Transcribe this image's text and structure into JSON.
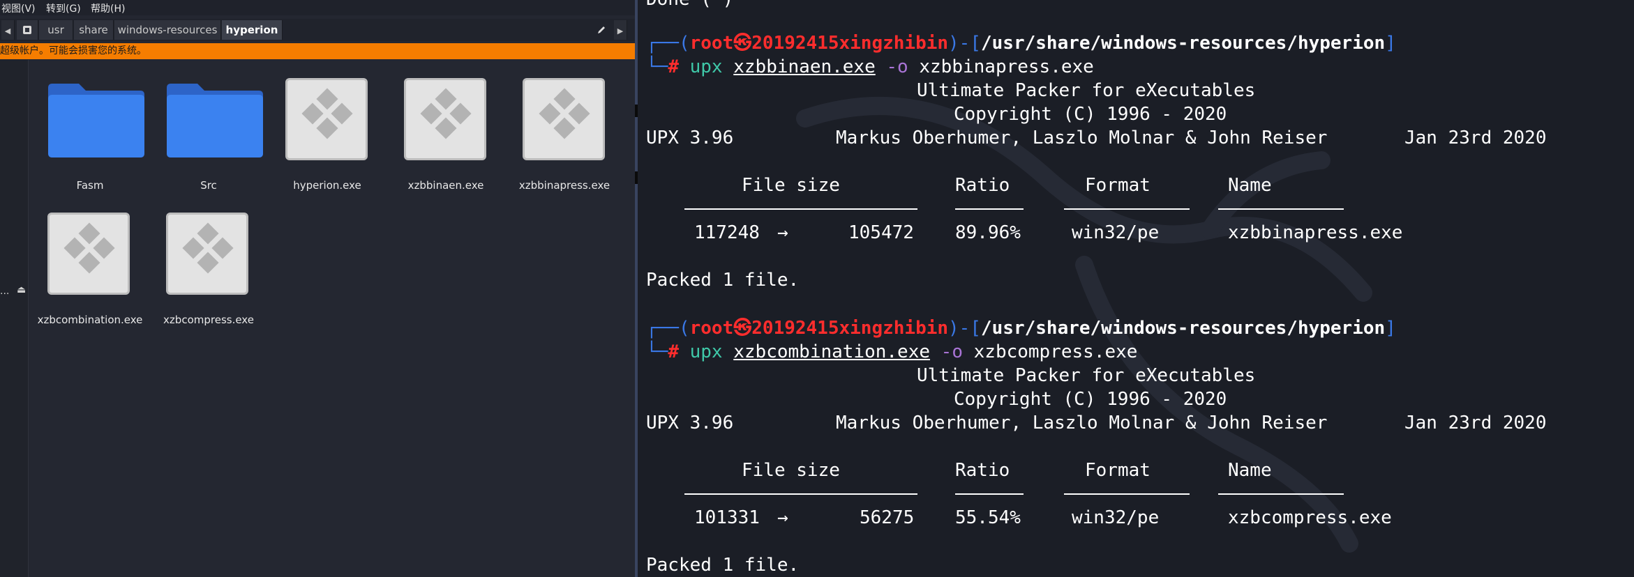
{
  "menubar": {
    "view": "视图(V)",
    "goto": "转到(G)",
    "help": "帮助(H)"
  },
  "pathbar": {
    "crumbs": [
      "usr",
      "share",
      "windows-resources",
      "hyperion"
    ]
  },
  "warning": "超级帐户。可能会损害您的系统。",
  "sidepanel": {
    "ellipsis": "...",
    "eject": "⏏"
  },
  "files": [
    {
      "name": "Fasm",
      "type": "folder"
    },
    {
      "name": "Src",
      "type": "folder"
    },
    {
      "name": "hyperion.exe",
      "type": "exe"
    },
    {
      "name": "xzbbinaen.exe",
      "type": "exe"
    },
    {
      "name": "xzbbinapress.exe",
      "type": "exe"
    },
    {
      "name": "xzbcombination.exe",
      "type": "exe"
    },
    {
      "name": "xzbcompress.exe",
      "type": "exe"
    }
  ],
  "colors": {
    "folder": "#3b82f0",
    "warning": "#f57d00",
    "prompt_blue": "#3a78e6",
    "prompt_red": "#ff2d2d"
  },
  "terminal": {
    "top_partial": "Done (·)",
    "prompt": {
      "user": "root",
      "at": "㉿",
      "host": "20192415xingzhibin",
      "path": "/usr/share/windows-resources/hyperion",
      "hash": "#"
    },
    "runs": [
      {
        "cmd": "upx",
        "input": "xzbbinaen.exe",
        "flag": "-o",
        "output": "xzbbinapress.exe",
        "banner1": "Ultimate Packer for eXecutables",
        "banner2": "Copyright (C) 1996 - 2020",
        "version": "UPX 3.96",
        "authors": "Markus Oberhumer, Laszlo Molnar & John Reiser",
        "date": "Jan 23rd 2020",
        "headers": {
          "size": "File size",
          "ratio": "Ratio",
          "format": "Format",
          "name": "Name"
        },
        "orig": "117248",
        "arrow": "→",
        "packed": "105472",
        "ratio": "89.96%",
        "format": "win32/pe",
        "name": "xzbbinapress.exe",
        "result": "Packed 1 file."
      },
      {
        "cmd": "upx",
        "input": "xzbcombination.exe",
        "flag": "-o",
        "output": "xzbcompress.exe",
        "banner1": "Ultimate Packer for eXecutables",
        "banner2": "Copyright (C) 1996 - 2020",
        "version": "UPX 3.96",
        "authors": "Markus Oberhumer, Laszlo Molnar & John Reiser",
        "date": "Jan 23rd 2020",
        "headers": {
          "size": "File size",
          "ratio": "Ratio",
          "format": "Format",
          "name": "Name"
        },
        "orig": "101331",
        "arrow": "→",
        "packed": "56275",
        "ratio": "55.54%",
        "format": "win32/pe",
        "name": "xzbcompress.exe",
        "result": "Packed 1 file."
      }
    ]
  }
}
